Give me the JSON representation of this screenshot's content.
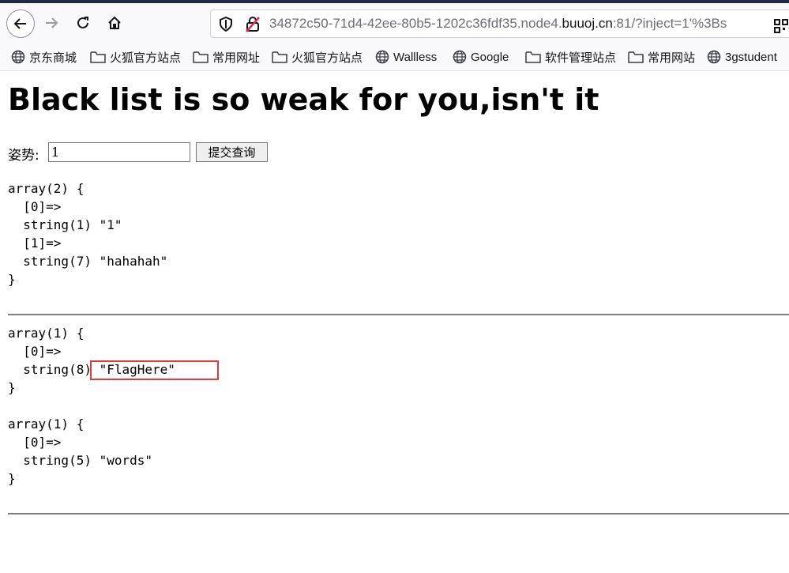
{
  "browser": {
    "url_prefix": "34872c50-71d4-42ee-80b5-1202c36fdf35.node4.",
    "url_domain": "buuoj.cn",
    "url_suffix": ":81/?inject=1'%3Bs"
  },
  "bookmarks": [
    {
      "label": "京东商城",
      "icon": "globe-icon"
    },
    {
      "label": "火狐官方站点",
      "icon": "folder-icon"
    },
    {
      "label": "常用网址",
      "icon": "folder-icon"
    },
    {
      "label": "火狐官方站点",
      "icon": "folder-icon"
    },
    {
      "label": "Wallless",
      "icon": "globe-icon"
    },
    {
      "label": "Google",
      "icon": "globe-icon"
    },
    {
      "label": "软件管理站点",
      "icon": "folder-icon"
    },
    {
      "label": "常用网站",
      "icon": "folder-icon"
    },
    {
      "label": "3gstudent",
      "icon": "globe-icon"
    }
  ],
  "page": {
    "title": "Black list is so weak for you,isn't it",
    "form_label": "姿势:",
    "inject_value": "1",
    "submit_label": "提交查询",
    "dump1": "array(2) {\n  [0]=>\n  string(1) \"1\"\n  [1]=>\n  string(7) \"hahahah\"\n}",
    "dump2": "array(1) {\n  [0]=>\n  string(8) \"FlagHere\"\n}",
    "dump3": "array(1) {\n  [0]=>\n  string(5) \"words\"\n}"
  },
  "colors": {
    "highlight": "#e03a3a",
    "rule": "#808080"
  }
}
